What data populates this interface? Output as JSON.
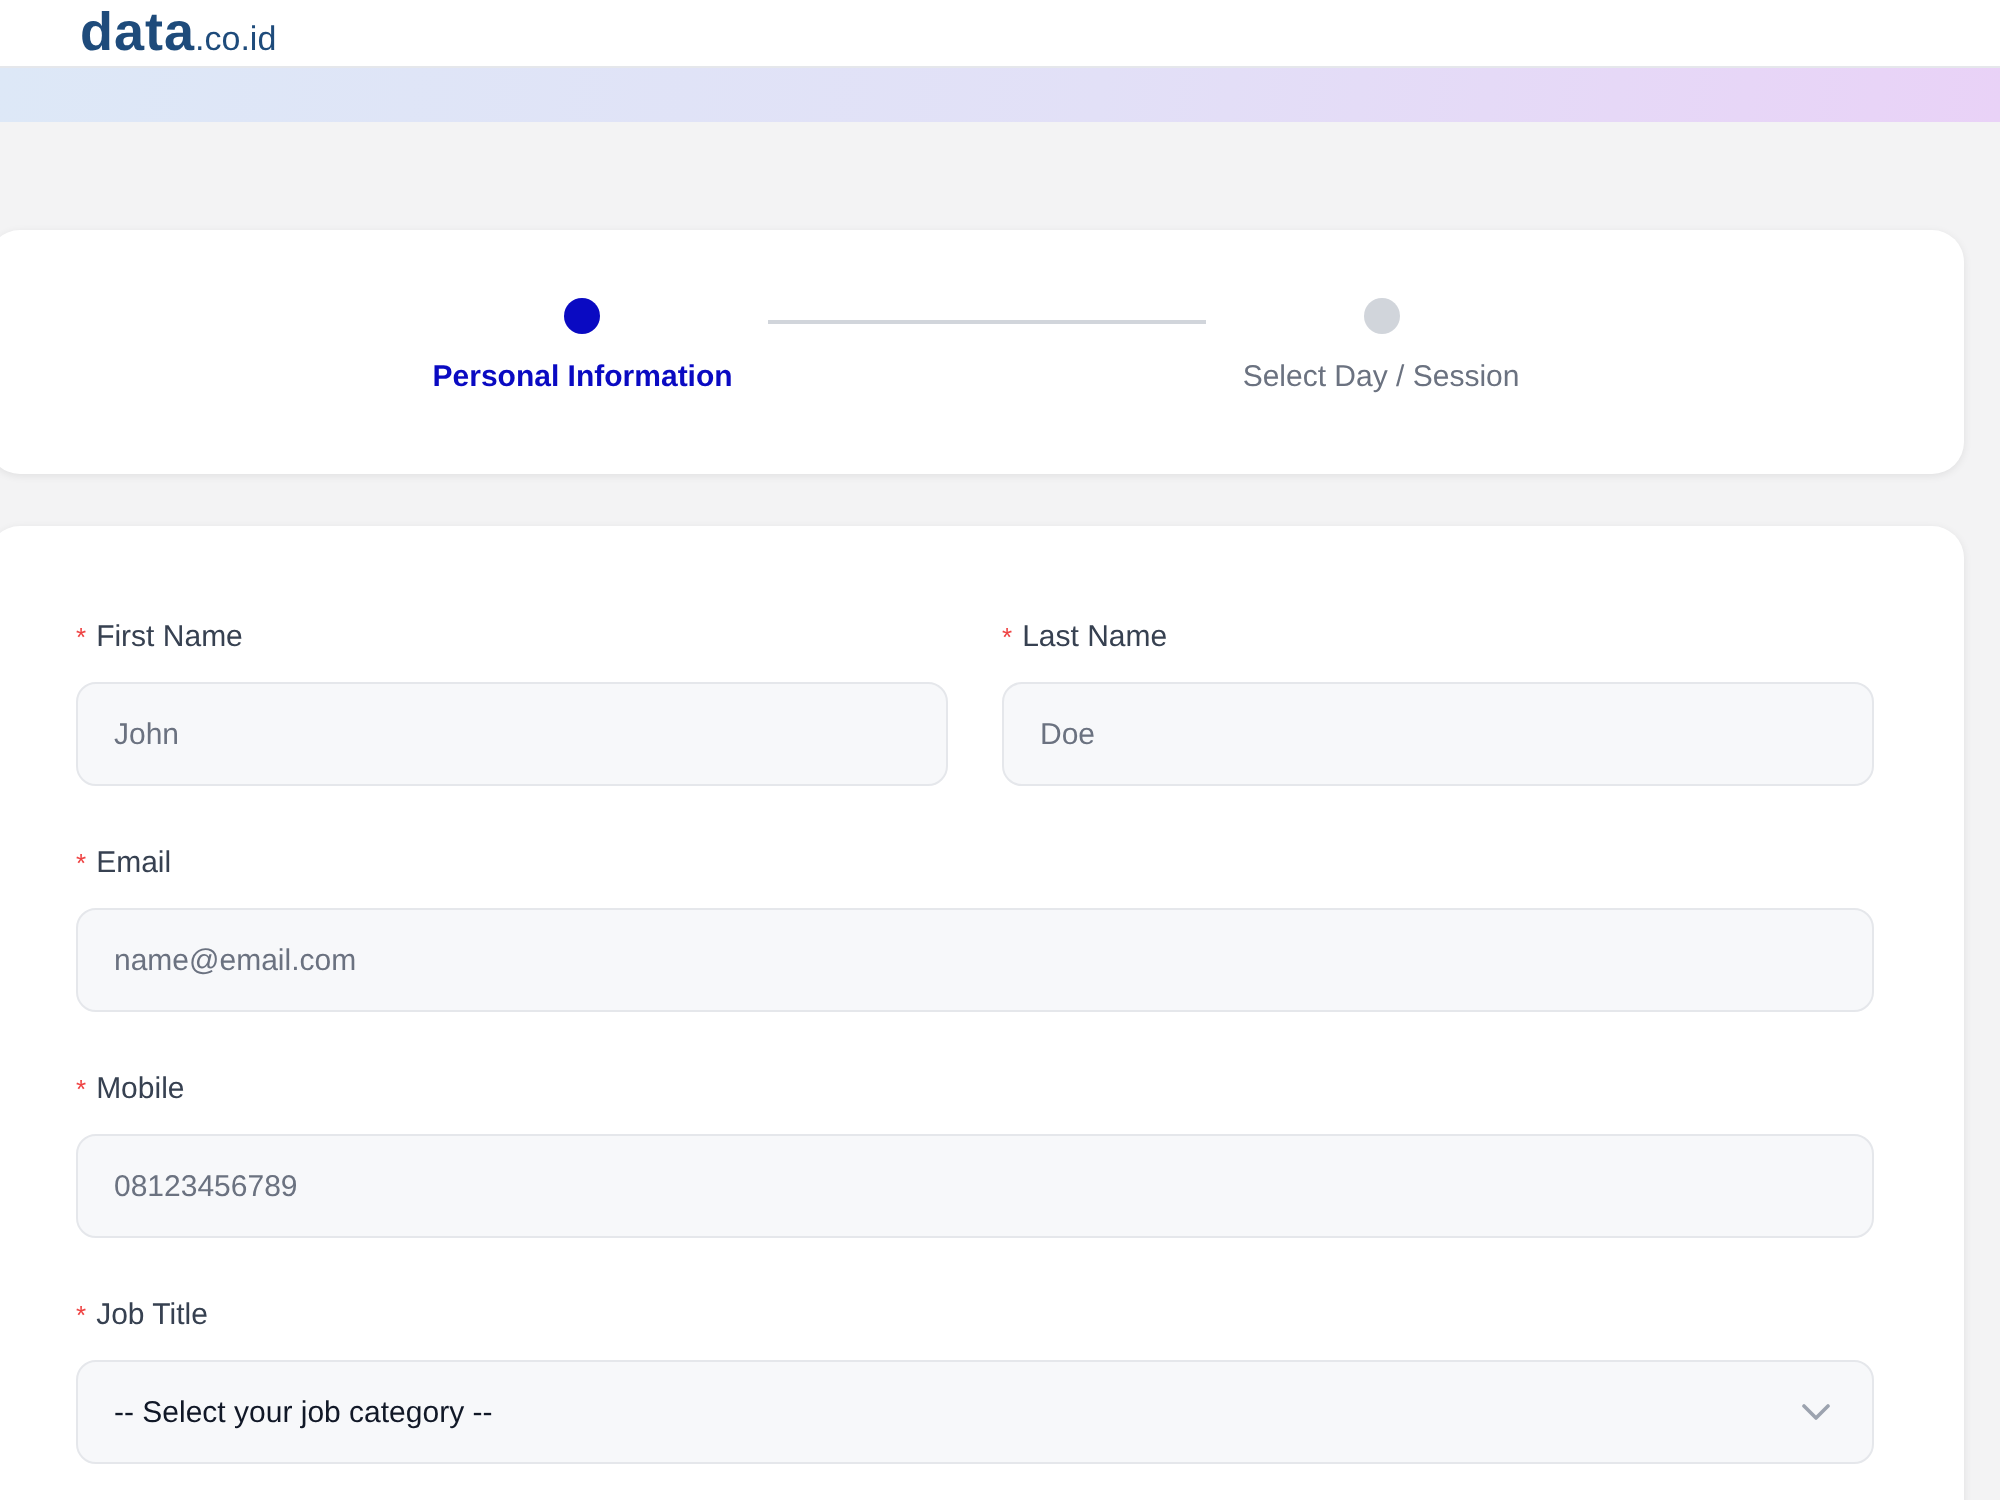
{
  "header": {
    "logo": "**data**.co.id"
  },
  "stepper": {
    "steps": [
      {
        "label": "Personal Information",
        "selected": true
      },
      {
        "label": "Select Day / Session",
        "selected": false
      }
    ]
  },
  "form": {
    "rows": [
      {
        "fields": [
          {
            "kind": "text",
            "required_mark": "*",
            "label": "First Name",
            "placeholder": "John"
          },
          {
            "kind": "text",
            "required_mark": "*",
            "label": "Last Name",
            "placeholder": "Doe"
          }
        ]
      },
      {
        "fields": [
          {
            "kind": "text",
            "required_mark": "*",
            "label": "Email",
            "placeholder": "name@email.com"
          }
        ]
      },
      {
        "fields": [
          {
            "kind": "text",
            "required_mark": "*",
            "label": "Mobile",
            "placeholder": "08123456789"
          }
        ]
      },
      {
        "fields": [
          {
            "kind": "select",
            "required_mark": "*",
            "label": "Job Title",
            "value": "-- Select your job category --"
          }
        ]
      }
    ]
  }
}
